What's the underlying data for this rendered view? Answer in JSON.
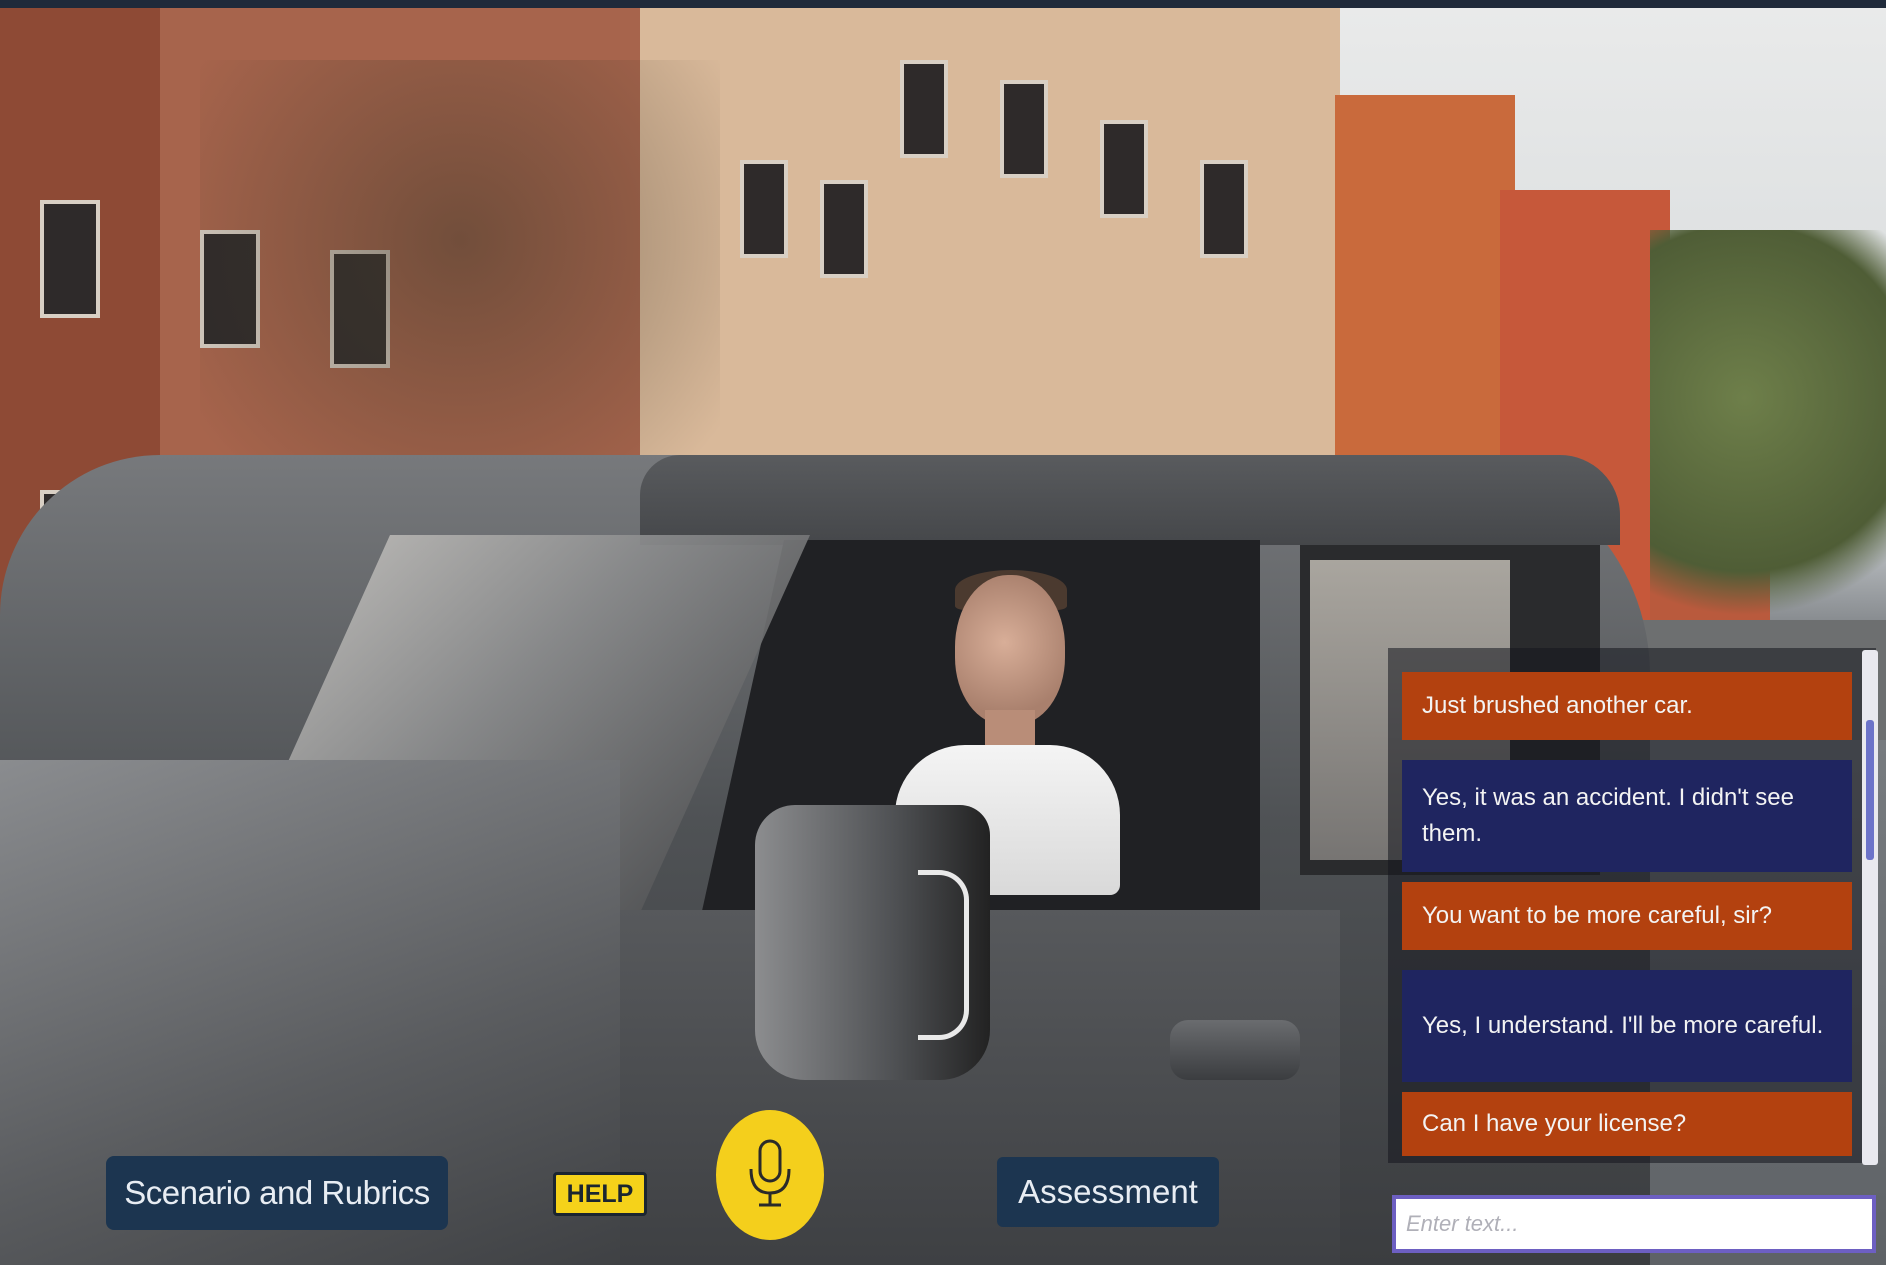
{
  "controls": {
    "scenario_label": "Scenario and Rubrics",
    "help_label": "HELP",
    "assessment_label": "Assessment",
    "mic_icon": "microphone-icon"
  },
  "chat": {
    "messages": [
      {
        "role": "officer",
        "text": "Just brushed another car."
      },
      {
        "role": "driver",
        "text": "Yes, it was an accident. I didn't see them."
      },
      {
        "role": "officer",
        "text": "You want to be more careful, sir?"
      },
      {
        "role": "driver",
        "text": "Yes, I understand. I'll be more careful."
      },
      {
        "role": "officer",
        "text": "Can I have your license?"
      }
    ],
    "input_placeholder": "Enter text..."
  },
  "colors": {
    "officer_bubble": "#b3410f",
    "driver_bubble": "#1f2560",
    "button_dark": "#1c3550",
    "accent_yellow": "#f4cf1c"
  }
}
